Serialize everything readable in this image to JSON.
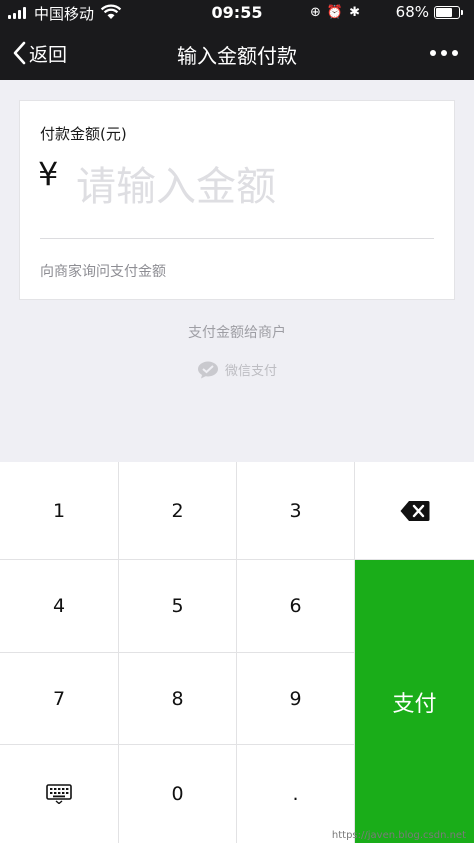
{
  "status_bar": {
    "carrier": "中国移动",
    "time": "09:55",
    "battery": "68%",
    "battery_level": 0.68,
    "icons": [
      "screen-lock-icon",
      "alarm-icon",
      "bluetooth-icon"
    ]
  },
  "nav": {
    "back_label": "返回",
    "title": "输入金额付款",
    "more_icon": "more-icon"
  },
  "card": {
    "amount_label": "付款金额(元)",
    "currency_symbol": "¥",
    "amount_placeholder": "请输入金额",
    "amount_value": "",
    "ask_merchant": "向商家询问支付金额"
  },
  "pay_to_merchant": "支付金额给商户",
  "wechat_pay": "微信支付",
  "keypad": {
    "keys": [
      "1",
      "2",
      "3",
      "4",
      "5",
      "6",
      "7",
      "8",
      "9",
      "0",
      "."
    ],
    "pay_label": "支付",
    "pay_color": "#1aad19",
    "delete_icon": "backspace-icon",
    "keyboard_icon": "keyboard-hide-icon"
  },
  "watermark": "https://javen.blog.csdn.net"
}
